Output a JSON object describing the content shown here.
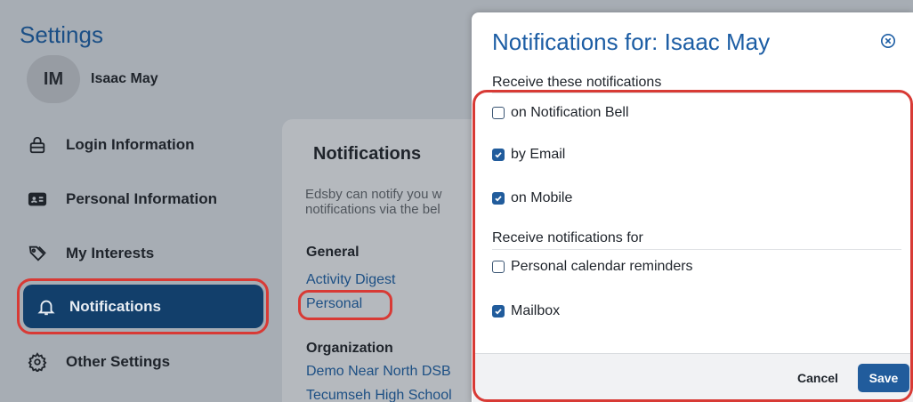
{
  "app": {
    "title": "Settings"
  },
  "user": {
    "initials": "IM",
    "name": "Isaac May"
  },
  "sidebar": {
    "items": [
      {
        "label": "Login Information",
        "icon": "lock-icon"
      },
      {
        "label": "Personal Information",
        "icon": "id-card-icon"
      },
      {
        "label": "My Interests",
        "icon": "tags-icon"
      },
      {
        "label": "Notifications",
        "icon": "bell-icon",
        "active": true
      },
      {
        "label": "Other Settings",
        "icon": "gear-icon"
      }
    ]
  },
  "content": {
    "title": "Notifications",
    "description": "Edsby can notify you w\nnotifications via the bel",
    "groups": [
      {
        "heading": "General",
        "links": [
          "Activity Digest",
          "Personal"
        ]
      },
      {
        "heading": "Organization",
        "links": [
          "Demo Near North DSB",
          "Tecumseh High School"
        ]
      }
    ]
  },
  "modal": {
    "title": "Notifications for: Isaac May",
    "receive_label": "Receive these notifications",
    "channels": [
      {
        "label": "on Notification Bell",
        "checked": false
      },
      {
        "label": "by Email",
        "checked": true
      },
      {
        "label": "on Mobile",
        "checked": true
      }
    ],
    "for_label": "Receive notifications for",
    "categories": [
      {
        "label": "Personal calendar reminders",
        "checked": false
      },
      {
        "label": "Mailbox",
        "checked": true
      }
    ],
    "cancel_label": "Cancel",
    "save_label": "Save"
  },
  "colors": {
    "accent": "#215c9c",
    "sidebar_active": "#123f6b",
    "highlight": "#d83a35",
    "overlay": "#a7adb4"
  }
}
